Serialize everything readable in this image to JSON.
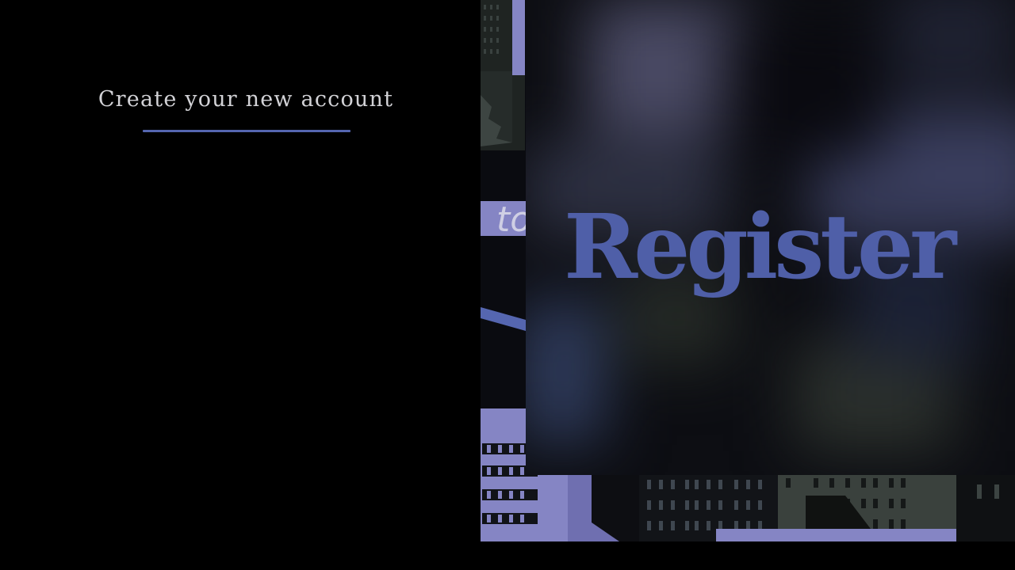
{
  "form": {
    "heading": "Create your new account"
  },
  "hero": {
    "title": "Register",
    "sign_fragment": "to"
  },
  "colors": {
    "background": "#000000",
    "accent": "#5566b0",
    "hero_text": "#4f5fa8",
    "heading_text": "#d2d2d6",
    "lavender": "#8585c4"
  }
}
